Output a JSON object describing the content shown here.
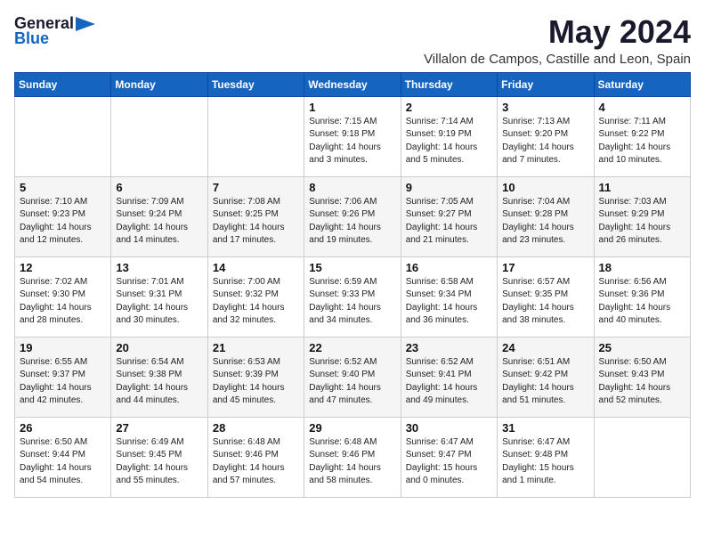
{
  "logo": {
    "general": "General",
    "blue": "Blue"
  },
  "title": {
    "month_year": "May 2024",
    "location": "Villalon de Campos, Castille and Leon, Spain"
  },
  "weekdays": [
    "Sunday",
    "Monday",
    "Tuesday",
    "Wednesday",
    "Thursday",
    "Friday",
    "Saturday"
  ],
  "weeks": [
    [
      {
        "day": "",
        "info": ""
      },
      {
        "day": "",
        "info": ""
      },
      {
        "day": "",
        "info": ""
      },
      {
        "day": "1",
        "info": "Sunrise: 7:15 AM\nSunset: 9:18 PM\nDaylight: 14 hours\nand 3 minutes."
      },
      {
        "day": "2",
        "info": "Sunrise: 7:14 AM\nSunset: 9:19 PM\nDaylight: 14 hours\nand 5 minutes."
      },
      {
        "day": "3",
        "info": "Sunrise: 7:13 AM\nSunset: 9:20 PM\nDaylight: 14 hours\nand 7 minutes."
      },
      {
        "day": "4",
        "info": "Sunrise: 7:11 AM\nSunset: 9:22 PM\nDaylight: 14 hours\nand 10 minutes."
      }
    ],
    [
      {
        "day": "5",
        "info": "Sunrise: 7:10 AM\nSunset: 9:23 PM\nDaylight: 14 hours\nand 12 minutes."
      },
      {
        "day": "6",
        "info": "Sunrise: 7:09 AM\nSunset: 9:24 PM\nDaylight: 14 hours\nand 14 minutes."
      },
      {
        "day": "7",
        "info": "Sunrise: 7:08 AM\nSunset: 9:25 PM\nDaylight: 14 hours\nand 17 minutes."
      },
      {
        "day": "8",
        "info": "Sunrise: 7:06 AM\nSunset: 9:26 PM\nDaylight: 14 hours\nand 19 minutes."
      },
      {
        "day": "9",
        "info": "Sunrise: 7:05 AM\nSunset: 9:27 PM\nDaylight: 14 hours\nand 21 minutes."
      },
      {
        "day": "10",
        "info": "Sunrise: 7:04 AM\nSunset: 9:28 PM\nDaylight: 14 hours\nand 23 minutes."
      },
      {
        "day": "11",
        "info": "Sunrise: 7:03 AM\nSunset: 9:29 PM\nDaylight: 14 hours\nand 26 minutes."
      }
    ],
    [
      {
        "day": "12",
        "info": "Sunrise: 7:02 AM\nSunset: 9:30 PM\nDaylight: 14 hours\nand 28 minutes."
      },
      {
        "day": "13",
        "info": "Sunrise: 7:01 AM\nSunset: 9:31 PM\nDaylight: 14 hours\nand 30 minutes."
      },
      {
        "day": "14",
        "info": "Sunrise: 7:00 AM\nSunset: 9:32 PM\nDaylight: 14 hours\nand 32 minutes."
      },
      {
        "day": "15",
        "info": "Sunrise: 6:59 AM\nSunset: 9:33 PM\nDaylight: 14 hours\nand 34 minutes."
      },
      {
        "day": "16",
        "info": "Sunrise: 6:58 AM\nSunset: 9:34 PM\nDaylight: 14 hours\nand 36 minutes."
      },
      {
        "day": "17",
        "info": "Sunrise: 6:57 AM\nSunset: 9:35 PM\nDaylight: 14 hours\nand 38 minutes."
      },
      {
        "day": "18",
        "info": "Sunrise: 6:56 AM\nSunset: 9:36 PM\nDaylight: 14 hours\nand 40 minutes."
      }
    ],
    [
      {
        "day": "19",
        "info": "Sunrise: 6:55 AM\nSunset: 9:37 PM\nDaylight: 14 hours\nand 42 minutes."
      },
      {
        "day": "20",
        "info": "Sunrise: 6:54 AM\nSunset: 9:38 PM\nDaylight: 14 hours\nand 44 minutes."
      },
      {
        "day": "21",
        "info": "Sunrise: 6:53 AM\nSunset: 9:39 PM\nDaylight: 14 hours\nand 45 minutes."
      },
      {
        "day": "22",
        "info": "Sunrise: 6:52 AM\nSunset: 9:40 PM\nDaylight: 14 hours\nand 47 minutes."
      },
      {
        "day": "23",
        "info": "Sunrise: 6:52 AM\nSunset: 9:41 PM\nDaylight: 14 hours\nand 49 minutes."
      },
      {
        "day": "24",
        "info": "Sunrise: 6:51 AM\nSunset: 9:42 PM\nDaylight: 14 hours\nand 51 minutes."
      },
      {
        "day": "25",
        "info": "Sunrise: 6:50 AM\nSunset: 9:43 PM\nDaylight: 14 hours\nand 52 minutes."
      }
    ],
    [
      {
        "day": "26",
        "info": "Sunrise: 6:50 AM\nSunset: 9:44 PM\nDaylight: 14 hours\nand 54 minutes."
      },
      {
        "day": "27",
        "info": "Sunrise: 6:49 AM\nSunset: 9:45 PM\nDaylight: 14 hours\nand 55 minutes."
      },
      {
        "day": "28",
        "info": "Sunrise: 6:48 AM\nSunset: 9:46 PM\nDaylight: 14 hours\nand 57 minutes."
      },
      {
        "day": "29",
        "info": "Sunrise: 6:48 AM\nSunset: 9:46 PM\nDaylight: 14 hours\nand 58 minutes."
      },
      {
        "day": "30",
        "info": "Sunrise: 6:47 AM\nSunset: 9:47 PM\nDaylight: 15 hours\nand 0 minutes."
      },
      {
        "day": "31",
        "info": "Sunrise: 6:47 AM\nSunset: 9:48 PM\nDaylight: 15 hours\nand 1 minute."
      },
      {
        "day": "",
        "info": ""
      }
    ]
  ]
}
